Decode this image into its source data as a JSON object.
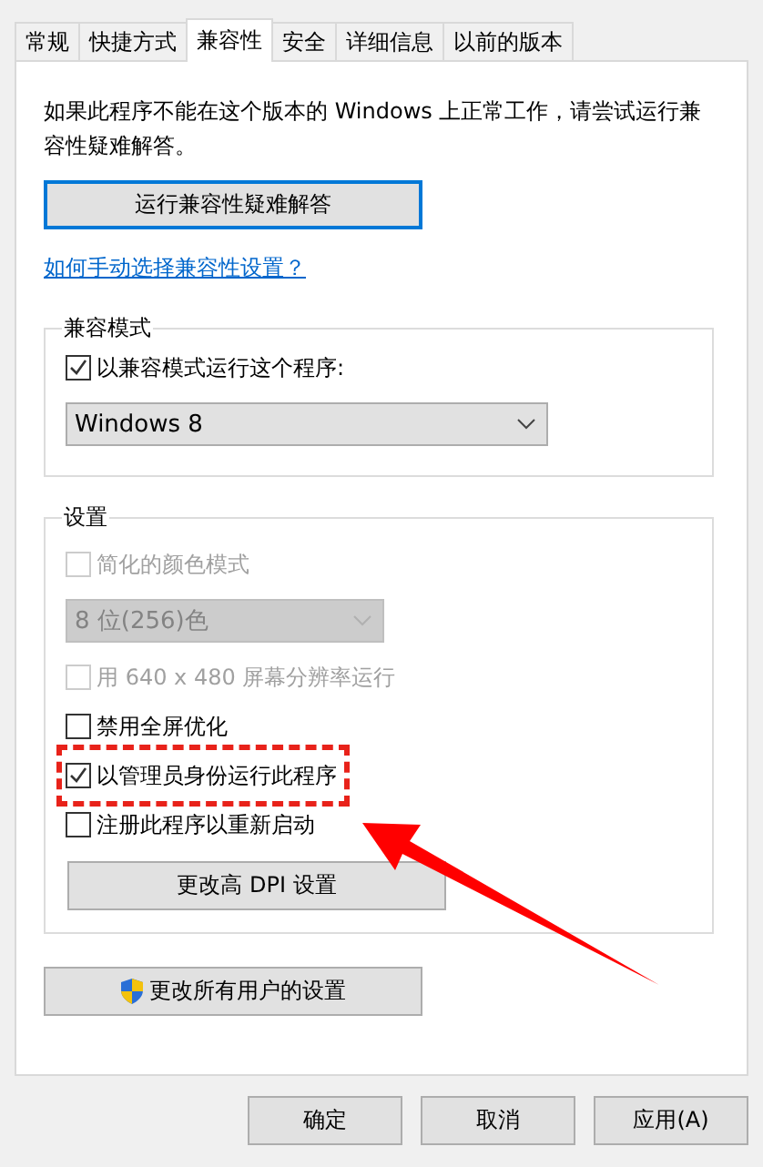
{
  "tabs": [
    {
      "label": "常规",
      "selected": false
    },
    {
      "label": "快捷方式",
      "selected": false
    },
    {
      "label": "兼容性",
      "selected": true
    },
    {
      "label": "安全",
      "selected": false
    },
    {
      "label": "详细信息",
      "selected": false
    },
    {
      "label": "以前的版本",
      "selected": false
    }
  ],
  "description": "如果此程序不能在这个版本的 Windows 上正常工作，请尝试运行兼容性疑难解答。",
  "troubleshoot_button": {
    "label": "运行兼容性疑难解答",
    "focused": true
  },
  "help_link": "如何手动选择兼容性设置？",
  "compat_mode": {
    "title": "兼容模式",
    "items": [
      {
        "kind": "checkbox",
        "label": "以兼容模式运行这个程序:",
        "checked": true,
        "disabled": false,
        "highlighted": false
      },
      {
        "kind": "dropdown",
        "value": "Windows 8",
        "disabled": false
      }
    ]
  },
  "settings": {
    "title": "设置",
    "items": [
      {
        "kind": "checkbox",
        "label": "简化的颜色模式",
        "checked": false,
        "disabled": true,
        "highlighted": false
      },
      {
        "kind": "dropdown",
        "value": "8 位(256)色",
        "disabled": true
      },
      {
        "kind": "checkbox",
        "label": "用 640 x 480 屏幕分辨率运行",
        "checked": false,
        "disabled": true,
        "highlighted": false
      },
      {
        "kind": "checkbox",
        "label": "禁用全屏优化",
        "checked": false,
        "disabled": false,
        "highlighted": false
      },
      {
        "kind": "checkbox",
        "label": "以管理员身份运行此程序",
        "checked": true,
        "disabled": false,
        "highlighted": true
      },
      {
        "kind": "checkbox",
        "label": "注册此程序以重新启动",
        "checked": false,
        "disabled": false,
        "highlighted": false
      },
      {
        "kind": "button",
        "label": "更改高 DPI 设置"
      }
    ]
  },
  "all_users_button": {
    "label": "更改所有用户的设置"
  },
  "buttons": [
    {
      "label": "确定"
    },
    {
      "label": "取消"
    },
    {
      "label": "应用(A)"
    }
  ]
}
